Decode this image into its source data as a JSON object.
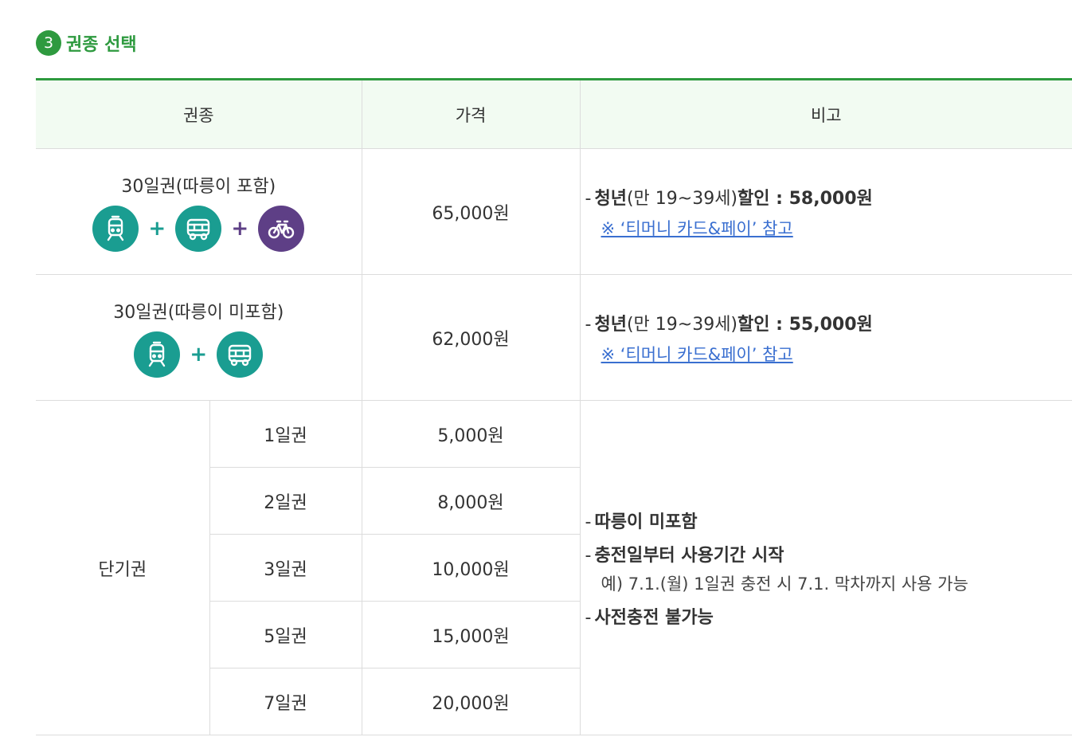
{
  "section": {
    "step": "3",
    "title": "권종 선택"
  },
  "headers": {
    "type": "권종",
    "price": "가격",
    "note": "비고"
  },
  "pass_with_bike": {
    "name": "30일권(따릉이 포함)",
    "icons": [
      "subway-icon",
      "bus-icon",
      "bicycle-icon"
    ],
    "plus": "+",
    "price": "65,000원",
    "note": {
      "dash": "-",
      "label": "청년",
      "condition": "(만 19~39세)",
      "discount_label": "할인 : 58,000원",
      "link": "※ ‘티머니 카드&페이’ 참고"
    }
  },
  "pass_without_bike": {
    "name": "30일권(따릉이 미포함)",
    "icons": [
      "subway-icon",
      "bus-icon"
    ],
    "plus": "+",
    "price": "62,000원",
    "note": {
      "dash": "-",
      "label": "청년",
      "condition": "(만 19~39세)",
      "discount_label": "할인 : 55,000원",
      "link": "※ ‘티머니 카드&페이’ 참고"
    }
  },
  "short_term": {
    "group_name": "단기권",
    "rows": [
      {
        "name": "1일권",
        "price": "5,000원"
      },
      {
        "name": "2일권",
        "price": "8,000원"
      },
      {
        "name": "3일권",
        "price": "10,000원"
      },
      {
        "name": "5일권",
        "price": "15,000원"
      },
      {
        "name": "7일권",
        "price": "20,000원"
      }
    ],
    "notes": {
      "dash": "-",
      "bike_excluded": "따릉이 미포함",
      "period_start": "충전일부터 사용기간 시작",
      "example": "예) 7.1.(월) 1일권 충전 시 7.1. 막차까지 사용 가능",
      "no_precharge": "사전충전 불가능"
    }
  },
  "colors": {
    "accent_green": "#2e9a3f",
    "header_bg": "#f2fbf2",
    "transit_teal": "#1a9d91",
    "bike_purple": "#5e3f86",
    "link_blue": "#3a6fd0"
  }
}
